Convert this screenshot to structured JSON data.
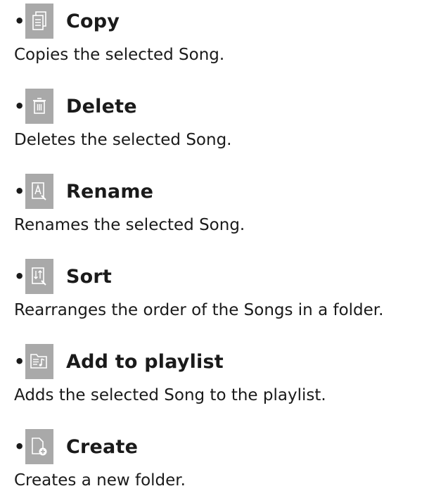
{
  "bullet": "•",
  "items": [
    {
      "icon": "copy-icon",
      "title": "Copy",
      "description": "Copies the selected Song."
    },
    {
      "icon": "trash-icon",
      "title": "Delete",
      "description": "Deletes the selected Song."
    },
    {
      "icon": "rename-icon",
      "title": "Rename",
      "description": "Renames the selected Song."
    },
    {
      "icon": "sort-icon",
      "title": "Sort",
      "description": "Rearranges the order of the Songs in a folder."
    },
    {
      "icon": "add-to-playlist-icon",
      "title": "Add to playlist",
      "description": "Adds the selected Song to the playlist."
    },
    {
      "icon": "create-folder-icon",
      "title": "Create",
      "description": "Creates a new folder."
    }
  ],
  "colors": {
    "icon_background": "#a9a9a9",
    "icon_foreground": "#ffffff",
    "text": "#1a1a1a"
  }
}
